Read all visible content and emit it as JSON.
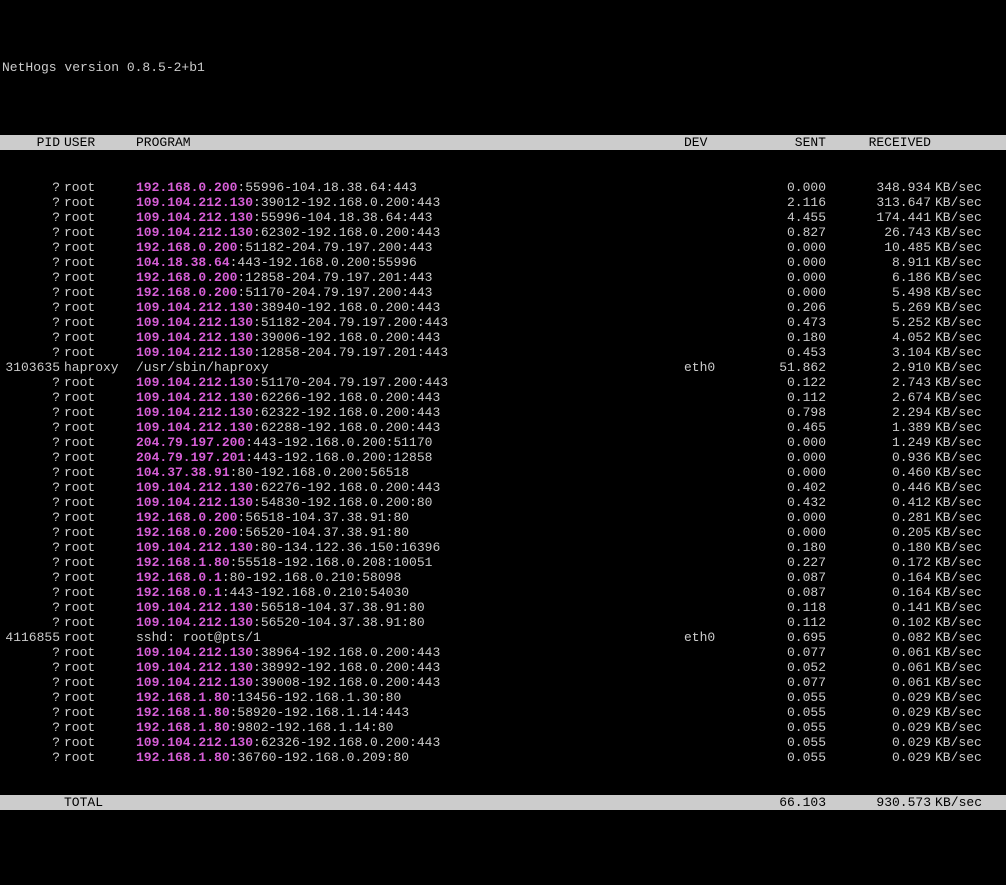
{
  "title": "NetHogs version 0.8.5-2+b1",
  "headers": {
    "pid": "PID",
    "user": "USER",
    "program": "PROGRAM",
    "dev": "DEV",
    "sent": "SENT",
    "received": "RECEIVED"
  },
  "unit": "KB/sec",
  "rows": [
    {
      "pid": "?",
      "user": "root",
      "ip": "192.168.0.200",
      "tail": ":55996-104.18.38.64:443",
      "dev": "",
      "sent": "0.000",
      "recv": "348.934"
    },
    {
      "pid": "?",
      "user": "root",
      "ip": "109.104.212.130",
      "tail": ":39012-192.168.0.200:443",
      "dev": "",
      "sent": "2.116",
      "recv": "313.647"
    },
    {
      "pid": "?",
      "user": "root",
      "ip": "109.104.212.130",
      "tail": ":55996-104.18.38.64:443",
      "dev": "",
      "sent": "4.455",
      "recv": "174.441"
    },
    {
      "pid": "?",
      "user": "root",
      "ip": "109.104.212.130",
      "tail": ":62302-192.168.0.200:443",
      "dev": "",
      "sent": "0.827",
      "recv": "26.743"
    },
    {
      "pid": "?",
      "user": "root",
      "ip": "192.168.0.200",
      "tail": ":51182-204.79.197.200:443",
      "dev": "",
      "sent": "0.000",
      "recv": "10.485"
    },
    {
      "pid": "?",
      "user": "root",
      "ip": "104.18.38.64",
      "tail": ":443-192.168.0.200:55996",
      "dev": "",
      "sent": "0.000",
      "recv": "8.911"
    },
    {
      "pid": "?",
      "user": "root",
      "ip": "192.168.0.200",
      "tail": ":12858-204.79.197.201:443",
      "dev": "",
      "sent": "0.000",
      "recv": "6.186"
    },
    {
      "pid": "?",
      "user": "root",
      "ip": "192.168.0.200",
      "tail": ":51170-204.79.197.200:443",
      "dev": "",
      "sent": "0.000",
      "recv": "5.498"
    },
    {
      "pid": "?",
      "user": "root",
      "ip": "109.104.212.130",
      "tail": ":38940-192.168.0.200:443",
      "dev": "",
      "sent": "0.206",
      "recv": "5.269"
    },
    {
      "pid": "?",
      "user": "root",
      "ip": "109.104.212.130",
      "tail": ":51182-204.79.197.200:443",
      "dev": "",
      "sent": "0.473",
      "recv": "5.252"
    },
    {
      "pid": "?",
      "user": "root",
      "ip": "109.104.212.130",
      "tail": ":39006-192.168.0.200:443",
      "dev": "",
      "sent": "0.180",
      "recv": "4.052"
    },
    {
      "pid": "?",
      "user": "root",
      "ip": "109.104.212.130",
      "tail": ":12858-204.79.197.201:443",
      "dev": "",
      "sent": "0.453",
      "recv": "3.104"
    },
    {
      "pid": "3103635",
      "user": "haproxy",
      "prog": "/usr/sbin/haproxy",
      "dev": "eth0",
      "sent": "51.862",
      "recv": "2.910"
    },
    {
      "pid": "?",
      "user": "root",
      "ip": "109.104.212.130",
      "tail": ":51170-204.79.197.200:443",
      "dev": "",
      "sent": "0.122",
      "recv": "2.743"
    },
    {
      "pid": "?",
      "user": "root",
      "ip": "109.104.212.130",
      "tail": ":62266-192.168.0.200:443",
      "dev": "",
      "sent": "0.112",
      "recv": "2.674"
    },
    {
      "pid": "?",
      "user": "root",
      "ip": "109.104.212.130",
      "tail": ":62322-192.168.0.200:443",
      "dev": "",
      "sent": "0.798",
      "recv": "2.294"
    },
    {
      "pid": "?",
      "user": "root",
      "ip": "109.104.212.130",
      "tail": ":62288-192.168.0.200:443",
      "dev": "",
      "sent": "0.465",
      "recv": "1.389"
    },
    {
      "pid": "?",
      "user": "root",
      "ip": "204.79.197.200",
      "tail": ":443-192.168.0.200:51170",
      "dev": "",
      "sent": "0.000",
      "recv": "1.249"
    },
    {
      "pid": "?",
      "user": "root",
      "ip": "204.79.197.201",
      "tail": ":443-192.168.0.200:12858",
      "dev": "",
      "sent": "0.000",
      "recv": "0.936"
    },
    {
      "pid": "?",
      "user": "root",
      "ip": "104.37.38.91",
      "tail": ":80-192.168.0.200:56518",
      "dev": "",
      "sent": "0.000",
      "recv": "0.460"
    },
    {
      "pid": "?",
      "user": "root",
      "ip": "109.104.212.130",
      "tail": ":62276-192.168.0.200:443",
      "dev": "",
      "sent": "0.402",
      "recv": "0.446"
    },
    {
      "pid": "?",
      "user": "root",
      "ip": "109.104.212.130",
      "tail": ":54830-192.168.0.200:80",
      "dev": "",
      "sent": "0.432",
      "recv": "0.412"
    },
    {
      "pid": "?",
      "user": "root",
      "ip": "192.168.0.200",
      "tail": ":56518-104.37.38.91:80",
      "dev": "",
      "sent": "0.000",
      "recv": "0.281"
    },
    {
      "pid": "?",
      "user": "root",
      "ip": "192.168.0.200",
      "tail": ":56520-104.37.38.91:80",
      "dev": "",
      "sent": "0.000",
      "recv": "0.205"
    },
    {
      "pid": "?",
      "user": "root",
      "ip": "109.104.212.130",
      "tail": ":80-134.122.36.150:16396",
      "dev": "",
      "sent": "0.180",
      "recv": "0.180"
    },
    {
      "pid": "?",
      "user": "root",
      "ip": "192.168.1.80",
      "tail": ":55518-192.168.0.208:10051",
      "dev": "",
      "sent": "0.227",
      "recv": "0.172"
    },
    {
      "pid": "?",
      "user": "root",
      "ip": "192.168.0.1",
      "tail": ":80-192.168.0.210:58098",
      "dev": "",
      "sent": "0.087",
      "recv": "0.164"
    },
    {
      "pid": "?",
      "user": "root",
      "ip": "192.168.0.1",
      "tail": ":443-192.168.0.210:54030",
      "dev": "",
      "sent": "0.087",
      "recv": "0.164"
    },
    {
      "pid": "?",
      "user": "root",
      "ip": "109.104.212.130",
      "tail": ":56518-104.37.38.91:80",
      "dev": "",
      "sent": "0.118",
      "recv": "0.141"
    },
    {
      "pid": "?",
      "user": "root",
      "ip": "109.104.212.130",
      "tail": ":56520-104.37.38.91:80",
      "dev": "",
      "sent": "0.112",
      "recv": "0.102"
    },
    {
      "pid": "4116855",
      "user": "root",
      "prog": "sshd: root@pts/1",
      "dev": "eth0",
      "sent": "0.695",
      "recv": "0.082"
    },
    {
      "pid": "?",
      "user": "root",
      "ip": "109.104.212.130",
      "tail": ":38964-192.168.0.200:443",
      "dev": "",
      "sent": "0.077",
      "recv": "0.061"
    },
    {
      "pid": "?",
      "user": "root",
      "ip": "109.104.212.130",
      "tail": ":38992-192.168.0.200:443",
      "dev": "",
      "sent": "0.052",
      "recv": "0.061"
    },
    {
      "pid": "?",
      "user": "root",
      "ip": "109.104.212.130",
      "tail": ":39008-192.168.0.200:443",
      "dev": "",
      "sent": "0.077",
      "recv": "0.061"
    },
    {
      "pid": "?",
      "user": "root",
      "ip": "192.168.1.80",
      "tail": ":13456-192.168.1.30:80",
      "dev": "",
      "sent": "0.055",
      "recv": "0.029"
    },
    {
      "pid": "?",
      "user": "root",
      "ip": "192.168.1.80",
      "tail": ":58920-192.168.1.14:443",
      "dev": "",
      "sent": "0.055",
      "recv": "0.029"
    },
    {
      "pid": "?",
      "user": "root",
      "ip": "192.168.1.80",
      "tail": ":9802-192.168.1.14:80",
      "dev": "",
      "sent": "0.055",
      "recv": "0.029"
    },
    {
      "pid": "?",
      "user": "root",
      "ip": "109.104.212.130",
      "tail": ":62326-192.168.0.200:443",
      "dev": "",
      "sent": "0.055",
      "recv": "0.029"
    },
    {
      "pid": "?",
      "user": "root",
      "ip": "192.168.1.80",
      "tail": ":36760-192.168.0.209:80",
      "dev": "",
      "sent": "0.055",
      "recv": "0.029"
    }
  ],
  "total": {
    "label": "TOTAL",
    "sent": "66.103",
    "recv": "930.573"
  }
}
